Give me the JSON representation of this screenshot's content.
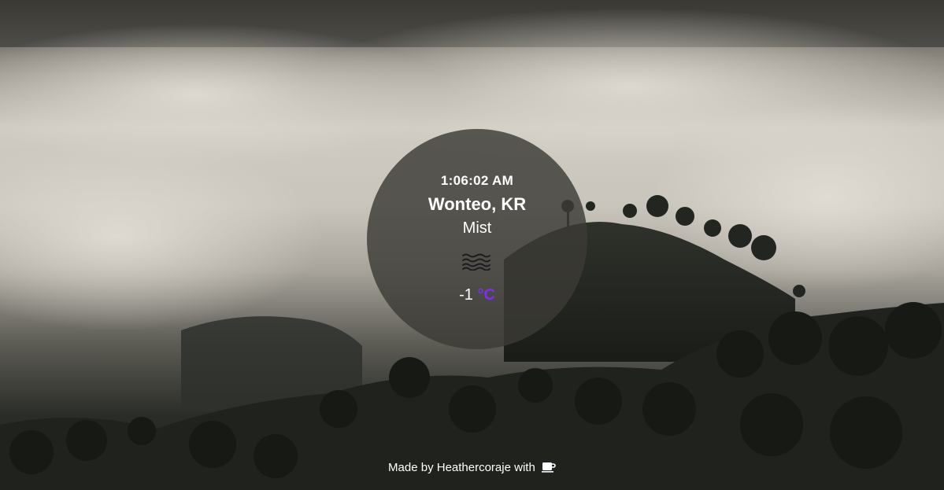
{
  "weather": {
    "time": "1:06:02 AM",
    "location": "Wonteo, KR",
    "condition": "Mist",
    "icon": "mist-icon",
    "temperature_value": "-1",
    "temperature_unit": "°C",
    "unit_color": "#7b2ff7"
  },
  "footer": {
    "text": "Made by Heathercoraje with",
    "icon": "coffee-icon"
  }
}
